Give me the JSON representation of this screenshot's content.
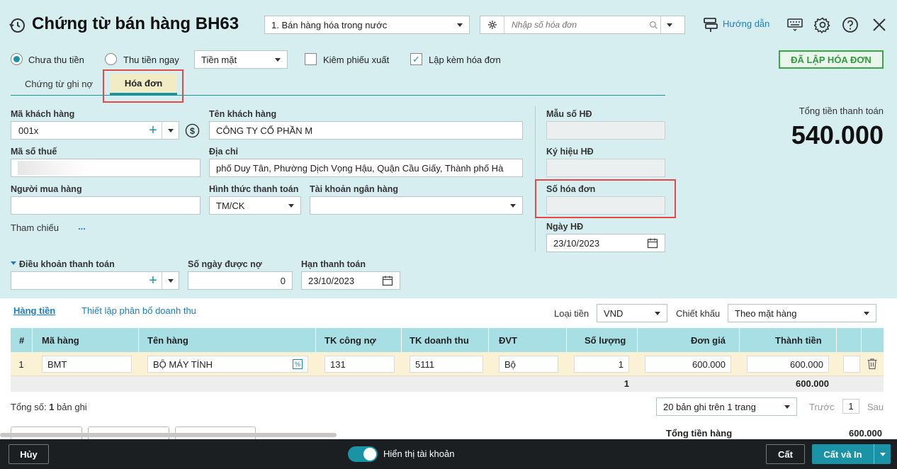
{
  "header": {
    "title": "Chứng từ bán hàng BH63",
    "type_select": "1. Bán hàng hóa trong nước",
    "invoice_placeholder": "Nhập số hóa đơn",
    "help_label": "Hướng dẫn"
  },
  "options": {
    "unpaid_label": "Chưa thu tiền",
    "paid_label": "Thu tiền ngay",
    "payment_method": "Tiền mặt",
    "export_label": "Kiêm phiếu xuất",
    "invoice_label": "Lập kèm hóa đơn",
    "status_badge": "ĐÃ LẬP HÓA ĐƠN"
  },
  "tabs": [
    {
      "label": "Chứng từ ghi nợ"
    },
    {
      "label": "Hóa đơn"
    }
  ],
  "form": {
    "customer_code_label": "Mã khách hàng",
    "customer_code": "001x",
    "customer_name_label": "Tên khách hàng",
    "customer_name": "CÔNG TY CỔ PHẦN M",
    "tax_code_label": "Mã số thuế",
    "address_label": "Địa chỉ",
    "address": "phố Duy Tân, Phường Dịch Vọng Hậu, Quận Cầu Giấy, Thành phố Hà",
    "buyer_label": "Người mua hàng",
    "pay_form_label": "Hình thức thanh toán",
    "pay_form": "TM/CK",
    "bank_label": "Tài khoản ngân hàng",
    "reference_label": "Tham chiếu",
    "reference_more": "...",
    "terms_label": "Điều khoản thanh toán",
    "credit_days_label": "Số ngày được nợ",
    "credit_days": "0",
    "due_date_label": "Hạn thanh toán",
    "due_date": "23/10/2023"
  },
  "invoice": {
    "template_label": "Mẫu số HĐ",
    "symbol_label": "Ký hiệu HĐ",
    "number_label": "Số hóa đơn",
    "date_label": "Ngày HĐ",
    "date": "23/10/2023"
  },
  "total": {
    "label": "Tổng tiền thanh toán",
    "value": "540.000"
  },
  "grid_toolbar": {
    "tab_goods": "Hàng tiền",
    "tab_revenue": "Thiết lập phân bổ doanh thu",
    "currency_label": "Loại tiền",
    "currency": "VND",
    "discount_label": "Chiết khấu",
    "discount": "Theo mặt hàng"
  },
  "table": {
    "headers": [
      "#",
      "Mã hàng",
      "Tên hàng",
      "TK công nợ",
      "TK doanh thu",
      "ĐVT",
      "Số lượng",
      "Đơn giá",
      "Thành tiền"
    ],
    "rows": [
      {
        "no": "1",
        "code": "BMT",
        "name": "BỘ MÁY TÍNH",
        "debt_acc": "131",
        "rev_acc": "5111",
        "unit": "Bộ",
        "qty": "1",
        "price": "600.000",
        "amount": "600.000"
      }
    ],
    "sum_qty": "1",
    "sum_amount": "600.000"
  },
  "footer": {
    "count_prefix": "Tổng số: ",
    "count_value": "1",
    "count_suffix": " bản ghi",
    "page_size": "20 bản ghi trên 1 trang",
    "prev": "Trước",
    "page": "1",
    "next": "Sau",
    "partial_label": "Tổng tiền hàng",
    "partial_value": "600.000"
  },
  "bottom": {
    "cancel": "Hủy",
    "toggle_label": "Hiển thị tài khoản",
    "toggle_on": true,
    "save": "Cất",
    "save_print": "Cất và In"
  }
}
